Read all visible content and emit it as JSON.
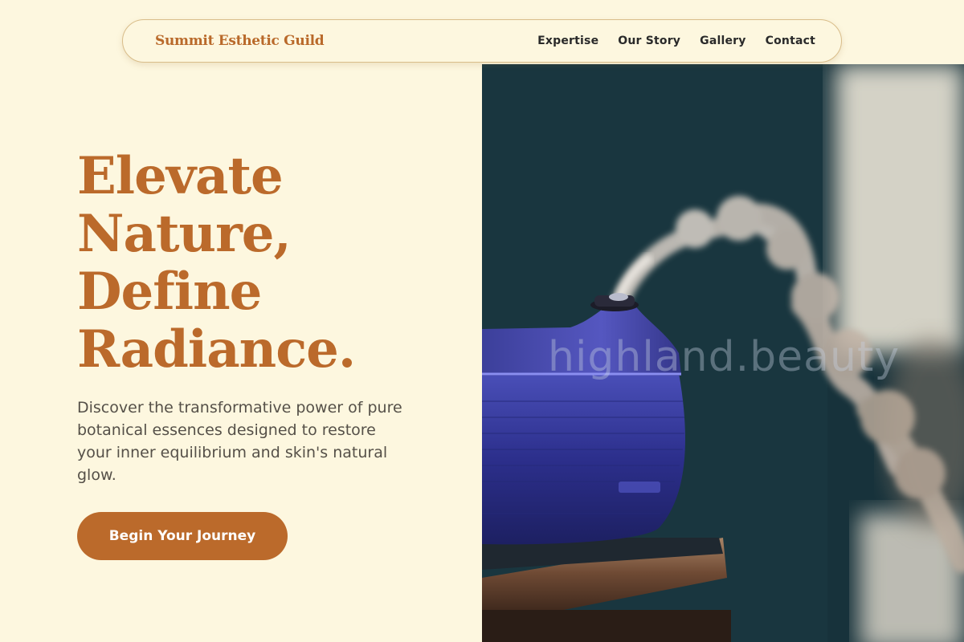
{
  "nav": {
    "brand": "Summit Esthetic Guild",
    "links": [
      {
        "label": "Expertise"
      },
      {
        "label": "Our Story"
      },
      {
        "label": "Gallery"
      },
      {
        "label": "Contact"
      }
    ]
  },
  "hero": {
    "headline_lines": [
      "Elevate",
      "Nature,",
      "Define",
      "Radiance."
    ],
    "description": "Discover the transformative power of pure botanical essences designed to restore your inner equilibrium and skin's natural glow.",
    "cta_label": "Begin Your Journey",
    "image": {
      "subject": "steaming-aroma-diffuser-photo",
      "watermark": "highland.beauty"
    }
  },
  "colors": {
    "background": "#fdf7df",
    "accent": "#bb6a2b",
    "text": "#2a2a2a",
    "body_text": "#555048"
  }
}
